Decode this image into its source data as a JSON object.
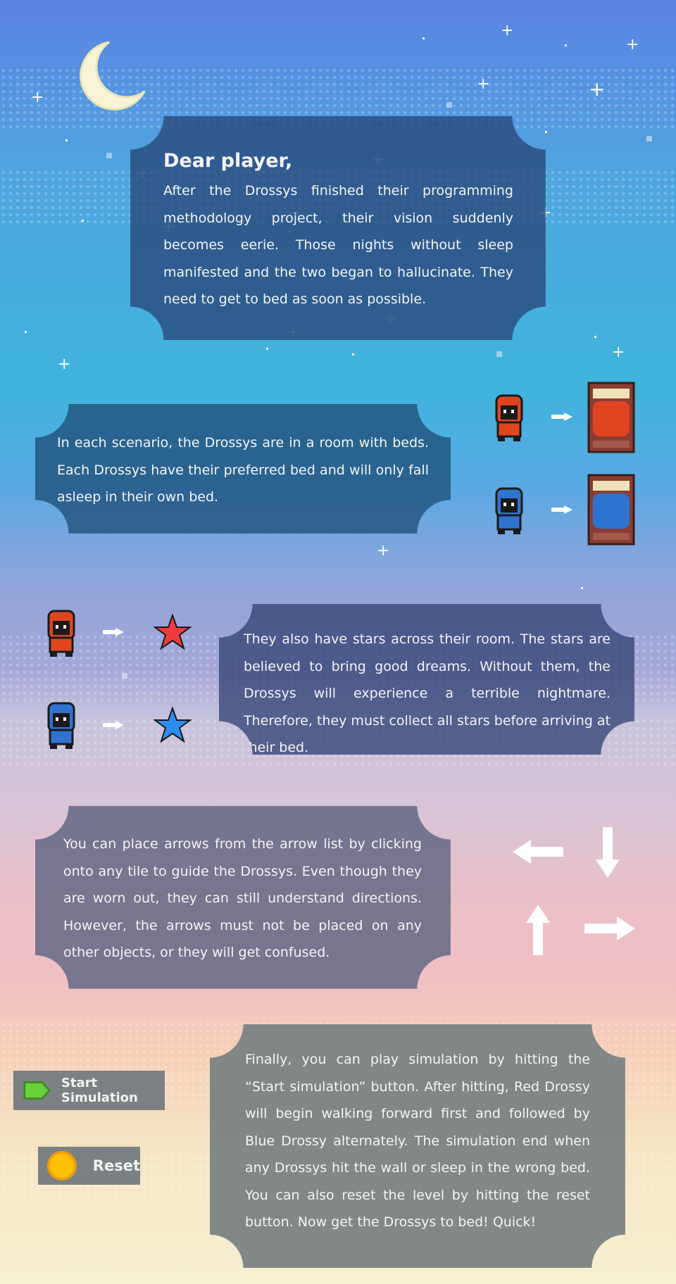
{
  "intro": {
    "greeting": "Dear player,",
    "body": "After the Drossys finished their programming methodology project, their vision suddenly becomes eerie. Those nights without sleep manifested and the two began to hallucinate. They need to get to bed as soon as possible."
  },
  "beds_section": {
    "body": "In each scenario, the Drossys are in a room with beds. Each Drossys have their preferred bed and will only fall asleep in their own bed."
  },
  "stars_section": {
    "body": "They also have stars across their room. The stars are believed to bring good dreams. Without them, the Drossys will experience a terrible nightmare. Therefore, they must collect all stars before arriving at their bed."
  },
  "arrows_section": {
    "body": "You can place arrows from the arrow list by clicking onto any tile to guide the Drossys. Even though they are worn out, they can still understand directions. However, the arrows must not be placed on any other objects, or they will get confused."
  },
  "simulation_section": {
    "body": "Finally, you can play simulation by hitting the “Start simulation” button. After hitting, Red Drossy will begin walking forward first and followed by Blue Drossy alternately. The simulation end when any Drossys hit the wall or sleep in the wrong bed. You can also reset the level by hitting the reset button. Now get the Drossys to bed! Quick!"
  },
  "buttons": {
    "start_label": "Start Simulation",
    "reset_label": "Reset"
  },
  "icons": {
    "moon": "crescent-moon-icon",
    "red_drossy": "red-drossy-sprite",
    "blue_drossy": "blue-drossy-sprite",
    "red_bed": "red-bed-icon",
    "blue_bed": "blue-bed-icon",
    "red_star": "red-star-icon",
    "blue_star": "blue-star-icon",
    "start": "green-flag-icon",
    "reset": "yellow-circle-icon"
  },
  "colors": {
    "red_drossy": "#e0451f",
    "blue_drossy": "#2f73d1",
    "red_star": "#ef3b3b",
    "blue_star": "#2d8cf0",
    "start_icon": "#6ad03c",
    "reset_icon": "#ffc107"
  }
}
